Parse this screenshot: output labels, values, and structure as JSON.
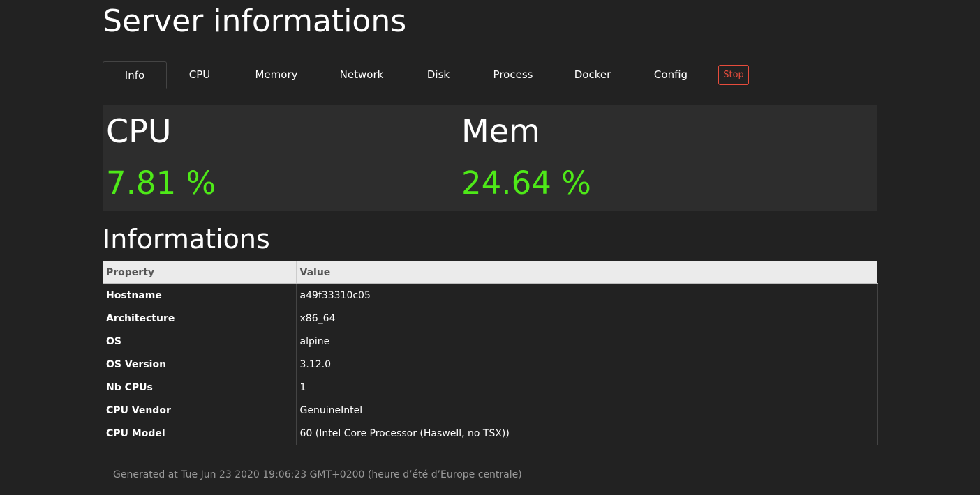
{
  "header": {
    "title": "Server informations"
  },
  "tabs": [
    {
      "label": "Info",
      "active": true
    },
    {
      "label": "CPU",
      "active": false
    },
    {
      "label": "Memory",
      "active": false
    },
    {
      "label": "Network",
      "active": false
    },
    {
      "label": "Disk",
      "active": false
    },
    {
      "label": "Process",
      "active": false
    },
    {
      "label": "Docker",
      "active": false
    },
    {
      "label": "Config",
      "active": false
    }
  ],
  "stop_button": {
    "label": "Stop",
    "color": "#e74c3c"
  },
  "stats": {
    "cpu": {
      "label": "CPU",
      "value": "7.81 %"
    },
    "mem": {
      "label": "Mem",
      "value": "24.64 %"
    },
    "value_color": "#4ee918"
  },
  "informations": {
    "title": "Informations",
    "columns": [
      "Property",
      "Value"
    ],
    "rows": [
      {
        "property": "Hostname",
        "value": "a49f33310c05"
      },
      {
        "property": "Architecture",
        "value": "x86_64"
      },
      {
        "property": "OS",
        "value": "alpine"
      },
      {
        "property": "OS Version",
        "value": "3.12.0"
      },
      {
        "property": "Nb CPUs",
        "value": "1"
      },
      {
        "property": "CPU Vendor",
        "value": "GenuineIntel"
      },
      {
        "property": "CPU Model",
        "value": "60 (Intel Core Processor (Haswell, no TSX))"
      }
    ]
  },
  "footer": {
    "text": "Generated at Tue Jun 23 2020 19:06:23 GMT+0200 (heure d’été d’Europe centrale)"
  }
}
